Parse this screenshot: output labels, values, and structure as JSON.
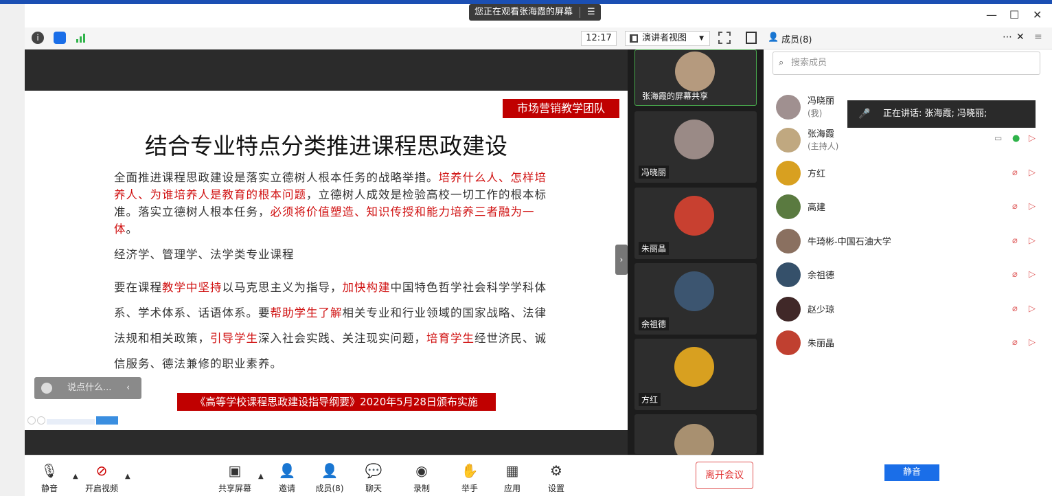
{
  "window": {
    "viewing_banner": "您正在观看张海霞的屏幕",
    "minimize": "—",
    "maximize": "☐",
    "close": "✕"
  },
  "toolbar": {
    "time": "12:17",
    "view_mode": "演讲者视图"
  },
  "slide": {
    "team_tag": "市场营销教学团队",
    "title": "结合专业特点分类推进课程思政建设",
    "para1": [
      {
        "text": "全面推进课程思政建设是落实立德树人根本任务的战略举措。",
        "red": false
      },
      {
        "text": "培养什么人、怎样培养人、为谁培养人是教育的根本问题",
        "red": true
      },
      {
        "text": "，立德树人成效是检验高校一切工作的根本标准。落实立德树人根本任务，",
        "red": false
      },
      {
        "text": "必须将价值塑造、知识传授和能力培养三者融为一体",
        "red": true
      },
      {
        "text": "。",
        "red": false
      }
    ],
    "subhead": "经济学、管理学、法学类专业课程",
    "para2": [
      {
        "text": "要在课程",
        "red": false
      },
      {
        "text": "教学中坚持",
        "red": true
      },
      {
        "text": "以马克思主义为指导，",
        "red": false
      },
      {
        "text": "加快构建",
        "red": true
      },
      {
        "text": "中国特色哲学社会科学学科体系、学术体系、话语体系。要",
        "red": false
      },
      {
        "text": "帮助学生了解",
        "red": true
      },
      {
        "text": "相关专业和行业领域的国家战略、法律法规和相关政策，",
        "red": false
      },
      {
        "text": "引导学生",
        "red": true
      },
      {
        "text": "深入社会实践、关注现实问题，",
        "red": false
      },
      {
        "text": "培育学生",
        "red": true
      },
      {
        "text": "经世济民、诚信服务、德法兼修的职业素养。",
        "red": false
      }
    ],
    "bottom_tag": "《高等学校课程思政建设指导纲要》2020年5月28日颁布实施"
  },
  "chat_input": {
    "placeholder": "说点什么..."
  },
  "thumbnails": [
    {
      "name": "张海霞的屏幕共享",
      "color": "#b59a7e"
    },
    {
      "name": "冯晓丽",
      "color": "#9a8a86"
    },
    {
      "name": "朱丽晶",
      "color": "#c84030"
    },
    {
      "name": "余祖德",
      "color": "#3c5570"
    },
    {
      "name": "方红",
      "color": "#d8a020"
    },
    {
      "name": "",
      "color": "#a89070"
    }
  ],
  "members_panel": {
    "title": "成员(8)",
    "search_placeholder": "搜索成员",
    "speaking": "正在讲话: 张海霞; 冯晓丽;",
    "mute_all": "静音",
    "members": [
      {
        "name": "冯晓丽",
        "sub": "(我)",
        "color": "#a09090"
      },
      {
        "name": "张海霞",
        "sub": "(主持人)",
        "color": "#c0a880"
      },
      {
        "name": "方红",
        "sub": "",
        "color": "#d8a020"
      },
      {
        "name": "高建",
        "sub": "",
        "color": "#5a7a40"
      },
      {
        "name": "牛琦彬-中国石油大学",
        "sub": "",
        "color": "#8a7060"
      },
      {
        "name": "余祖德",
        "sub": "",
        "color": "#35506a"
      },
      {
        "name": "赵少琼",
        "sub": "",
        "color": "#402828"
      },
      {
        "name": "朱丽晶",
        "sub": "",
        "color": "#c04030"
      }
    ]
  },
  "bottom_bar": {
    "mute": "静音",
    "video": "开启视频",
    "share": "共享屏幕",
    "invite": "邀请",
    "members": "成员(8)",
    "chat": "聊天",
    "record": "录制",
    "raise_hand": "举手",
    "apps": "应用",
    "settings": "设置",
    "leave": "离开会议"
  }
}
